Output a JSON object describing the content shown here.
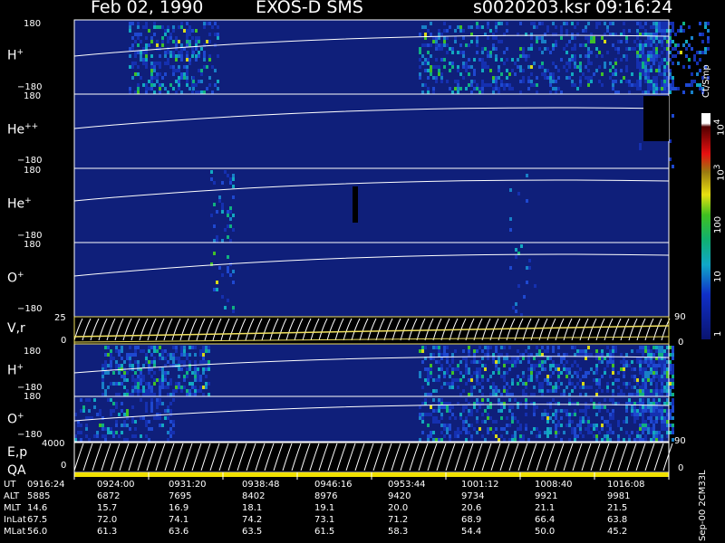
{
  "header": {
    "date": "Feb 02, 1990",
    "instrument": "EXOS-D SMS",
    "file": "s0020203.ksr",
    "time": "09:16:24"
  },
  "colors": {
    "background": "#000000",
    "panel": "#0f1f7a",
    "axis": "#ffffff",
    "yellow_panel_line": "#f0e060"
  },
  "panels": [
    {
      "id": "h-plus-top",
      "label_base": "H",
      "label_sup": "+",
      "ytop": "180",
      "ybot": "−180"
    },
    {
      "id": "he-plus-plus",
      "label_base": "He",
      "label_sup": "++",
      "ytop": "180",
      "ybot": "−180"
    },
    {
      "id": "he-plus",
      "label_base": "He",
      "label_sup": "+",
      "ytop": "180",
      "ybot": "−180"
    },
    {
      "id": "o-plus-top",
      "label_base": "O",
      "label_sup": "+",
      "ytop": "180",
      "ybot": "−180"
    },
    {
      "id": "vr",
      "label_base": "V,r",
      "label_sup": "",
      "ytop": "25",
      "ybot": "0",
      "right_top": "90",
      "right_bot": "0"
    },
    {
      "id": "h-plus-bottom",
      "label_base": "H",
      "label_sup": "+",
      "ytop": "180",
      "ybot": "−180"
    },
    {
      "id": "o-plus-bottom",
      "label_base": "O",
      "label_sup": "+",
      "ytop": "180",
      "ybot": "−180"
    },
    {
      "id": "ep",
      "label_base": "E,p",
      "label_sup": "",
      "ytop": "4000",
      "ybot": "0",
      "right_top": "90",
      "right_bot": "0"
    }
  ],
  "qa_label": "QA",
  "colorbar": {
    "unit": "Ct/Smp",
    "ticks": [
      {
        "base": "10",
        "sup": "4"
      },
      {
        "base": "10",
        "sup": "3"
      },
      {
        "base": "100",
        "sup": ""
      },
      {
        "base": "10",
        "sup": ""
      },
      {
        "base": "1",
        "sup": ""
      }
    ]
  },
  "footer": {
    "rows": [
      {
        "label": "UT",
        "values": [
          "0916:24",
          "0924:00",
          "0931:20",
          "0938:48",
          "0946:16",
          "0953:44",
          "1001:12",
          "1008:40",
          "1016:08"
        ]
      },
      {
        "label": "ALT",
        "values": [
          "5885",
          "6872",
          "7695",
          "8402",
          "8976",
          "9420",
          "9734",
          "9921",
          "9981"
        ]
      },
      {
        "label": "MLT",
        "values": [
          "14.6",
          "15.7",
          "16.9",
          "18.1",
          "19.1",
          "20.0",
          "20.6",
          "21.1",
          "21.5"
        ]
      },
      {
        "label": "InLat",
        "values": [
          "67.5",
          "72.0",
          "74.1",
          "74.2",
          "73.1",
          "71.2",
          "68.9",
          "66.4",
          "63.8"
        ]
      },
      {
        "label": "MLat",
        "values": [
          "56.0",
          "61.3",
          "63.6",
          "63.5",
          "61.5",
          "58.3",
          "54.4",
          "50.0",
          "45.2"
        ]
      }
    ],
    "version": "Sep-00  2CM33L"
  }
}
